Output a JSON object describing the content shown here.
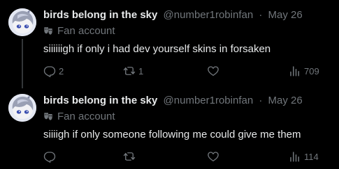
{
  "colors": {
    "background": "#000000",
    "primary_text": "#e7e9ea",
    "secondary_text": "#71767b",
    "thread_line": "#333639"
  },
  "icons": {
    "reply": "reply-icon",
    "retweet": "retweet-icon",
    "like": "like-icon",
    "views": "views-icon",
    "badge": "theater-mask-icon"
  },
  "tweets": [
    {
      "display_name": "birds belong in the sky",
      "handle": "@number1robinfan",
      "separator": "·",
      "date": "May 26",
      "badge": "Fan account",
      "text": "siiiiiigh if only i had dev yourself skins in forsaken",
      "replies": "2",
      "retweets": "1",
      "likes": "",
      "views": "709"
    },
    {
      "display_name": "birds belong in the sky",
      "handle": "@number1robinfan",
      "separator": "·",
      "date": "May 26",
      "badge": "Fan account",
      "text": "siiiigh if only someone following me could give me them",
      "replies": "",
      "retweets": "",
      "likes": "",
      "views": "114"
    }
  ]
}
